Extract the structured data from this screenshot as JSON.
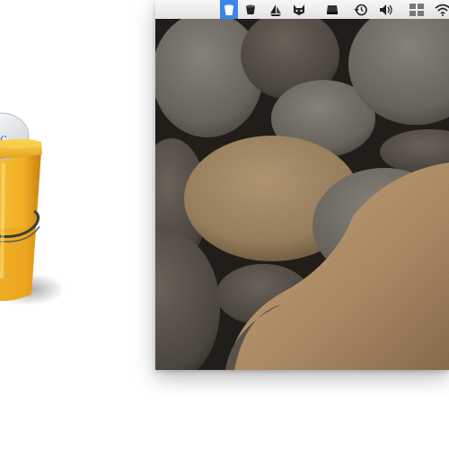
{
  "app_icon": {
    "name": "bucket-app-icon",
    "label_fragment": "ic",
    "colors": {
      "bucket": "#f2b42a",
      "bucket_dark": "#c8810d",
      "rim": "#f6c845",
      "band": "#3a3a3a",
      "disc": "#dfe4ea"
    }
  },
  "menubar": {
    "items": [
      {
        "name": "bucket-menu-icon",
        "selected": true
      },
      {
        "name": "cup-menu-icon",
        "selected": false
      },
      {
        "name": "sailboat-menu-icon",
        "selected": false
      },
      {
        "name": "cat-menu-icon",
        "selected": false
      },
      {
        "name": "drive-menu-icon",
        "selected": false
      },
      {
        "name": "time-machine-menu-icon",
        "selected": false
      },
      {
        "name": "volume-menu-icon",
        "selected": false
      },
      {
        "name": "spaces-menu-icon",
        "selected": false
      },
      {
        "name": "wifi-menu-icon",
        "selected": false
      }
    ],
    "selected_color": "#3a86ea"
  },
  "wallpaper": {
    "name": "pebbles-wallpaper",
    "colors": {
      "shadow": "#1f1c17",
      "gray_stone": "#6f6b63",
      "tan_stone": "#a68b63",
      "dark_stone": "#4c4640"
    }
  }
}
